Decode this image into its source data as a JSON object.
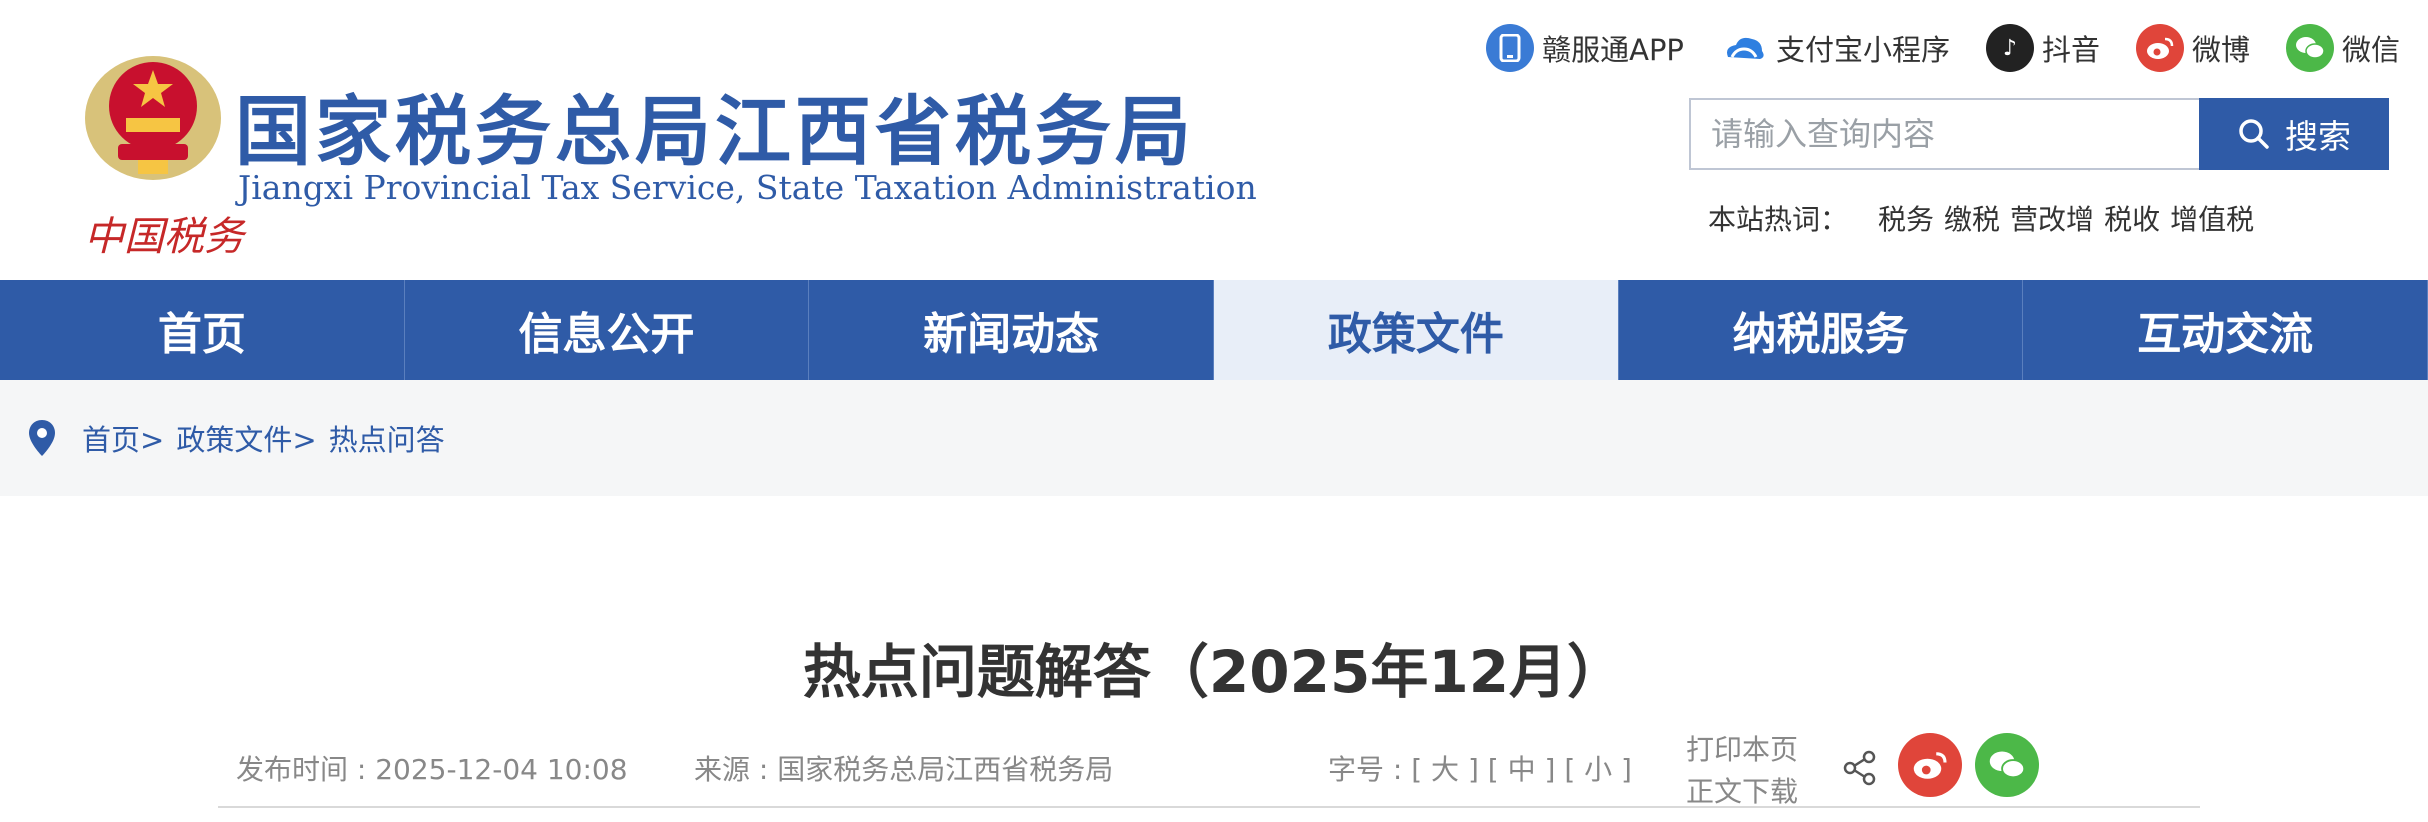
{
  "header": {
    "title_cn": "国家税务总局江西省税务局",
    "title_en": "Jiangxi Provincial Tax Service, State Taxation Administration",
    "slogan": "中国税务"
  },
  "social": [
    {
      "label": "赣服通APP",
      "icon": "phone-app-icon",
      "color": "#3a7bd5"
    },
    {
      "label": "支付宝小程序",
      "icon": "alipay-cloud-icon",
      "color": "#2f7fe0"
    },
    {
      "label": "抖音",
      "icon": "tiktok-icon",
      "color": "#222222"
    },
    {
      "label": "微博",
      "icon": "weibo-icon",
      "color": "#e0453a"
    },
    {
      "label": "微信",
      "icon": "wechat-icon",
      "color": "#4cb848"
    }
  ],
  "search": {
    "placeholder": "请输入查询内容",
    "button": "搜索"
  },
  "hot": {
    "label": "本站热词：",
    "items": [
      "税务",
      "缴税",
      "营改增",
      "税收",
      "增值税"
    ]
  },
  "nav": [
    {
      "label": "首页",
      "active": false
    },
    {
      "label": "信息公开",
      "active": false
    },
    {
      "label": "新闻动态",
      "active": false
    },
    {
      "label": "政策文件",
      "active": true
    },
    {
      "label": "纳税服务",
      "active": false
    },
    {
      "label": "互动交流",
      "active": false
    }
  ],
  "breadcrumb": [
    "首页>",
    "政策文件>",
    "热点问答"
  ],
  "article": {
    "title": "热点问题解答（2025年12月）",
    "publish_time": "发布时间 : 2025-12-04 10:08",
    "source": "来源 : 国家税务总局江西省税务局",
    "font_size": "字号 : [ 大 ] [ 中 ] [ 小 ]",
    "print": "打印本页",
    "download": "正文下载"
  },
  "colors": {
    "brand": "#2f5ba7",
    "nav_active_bg": "#e8eef8",
    "weibo": "#e0453a",
    "wechat": "#4cb848"
  }
}
